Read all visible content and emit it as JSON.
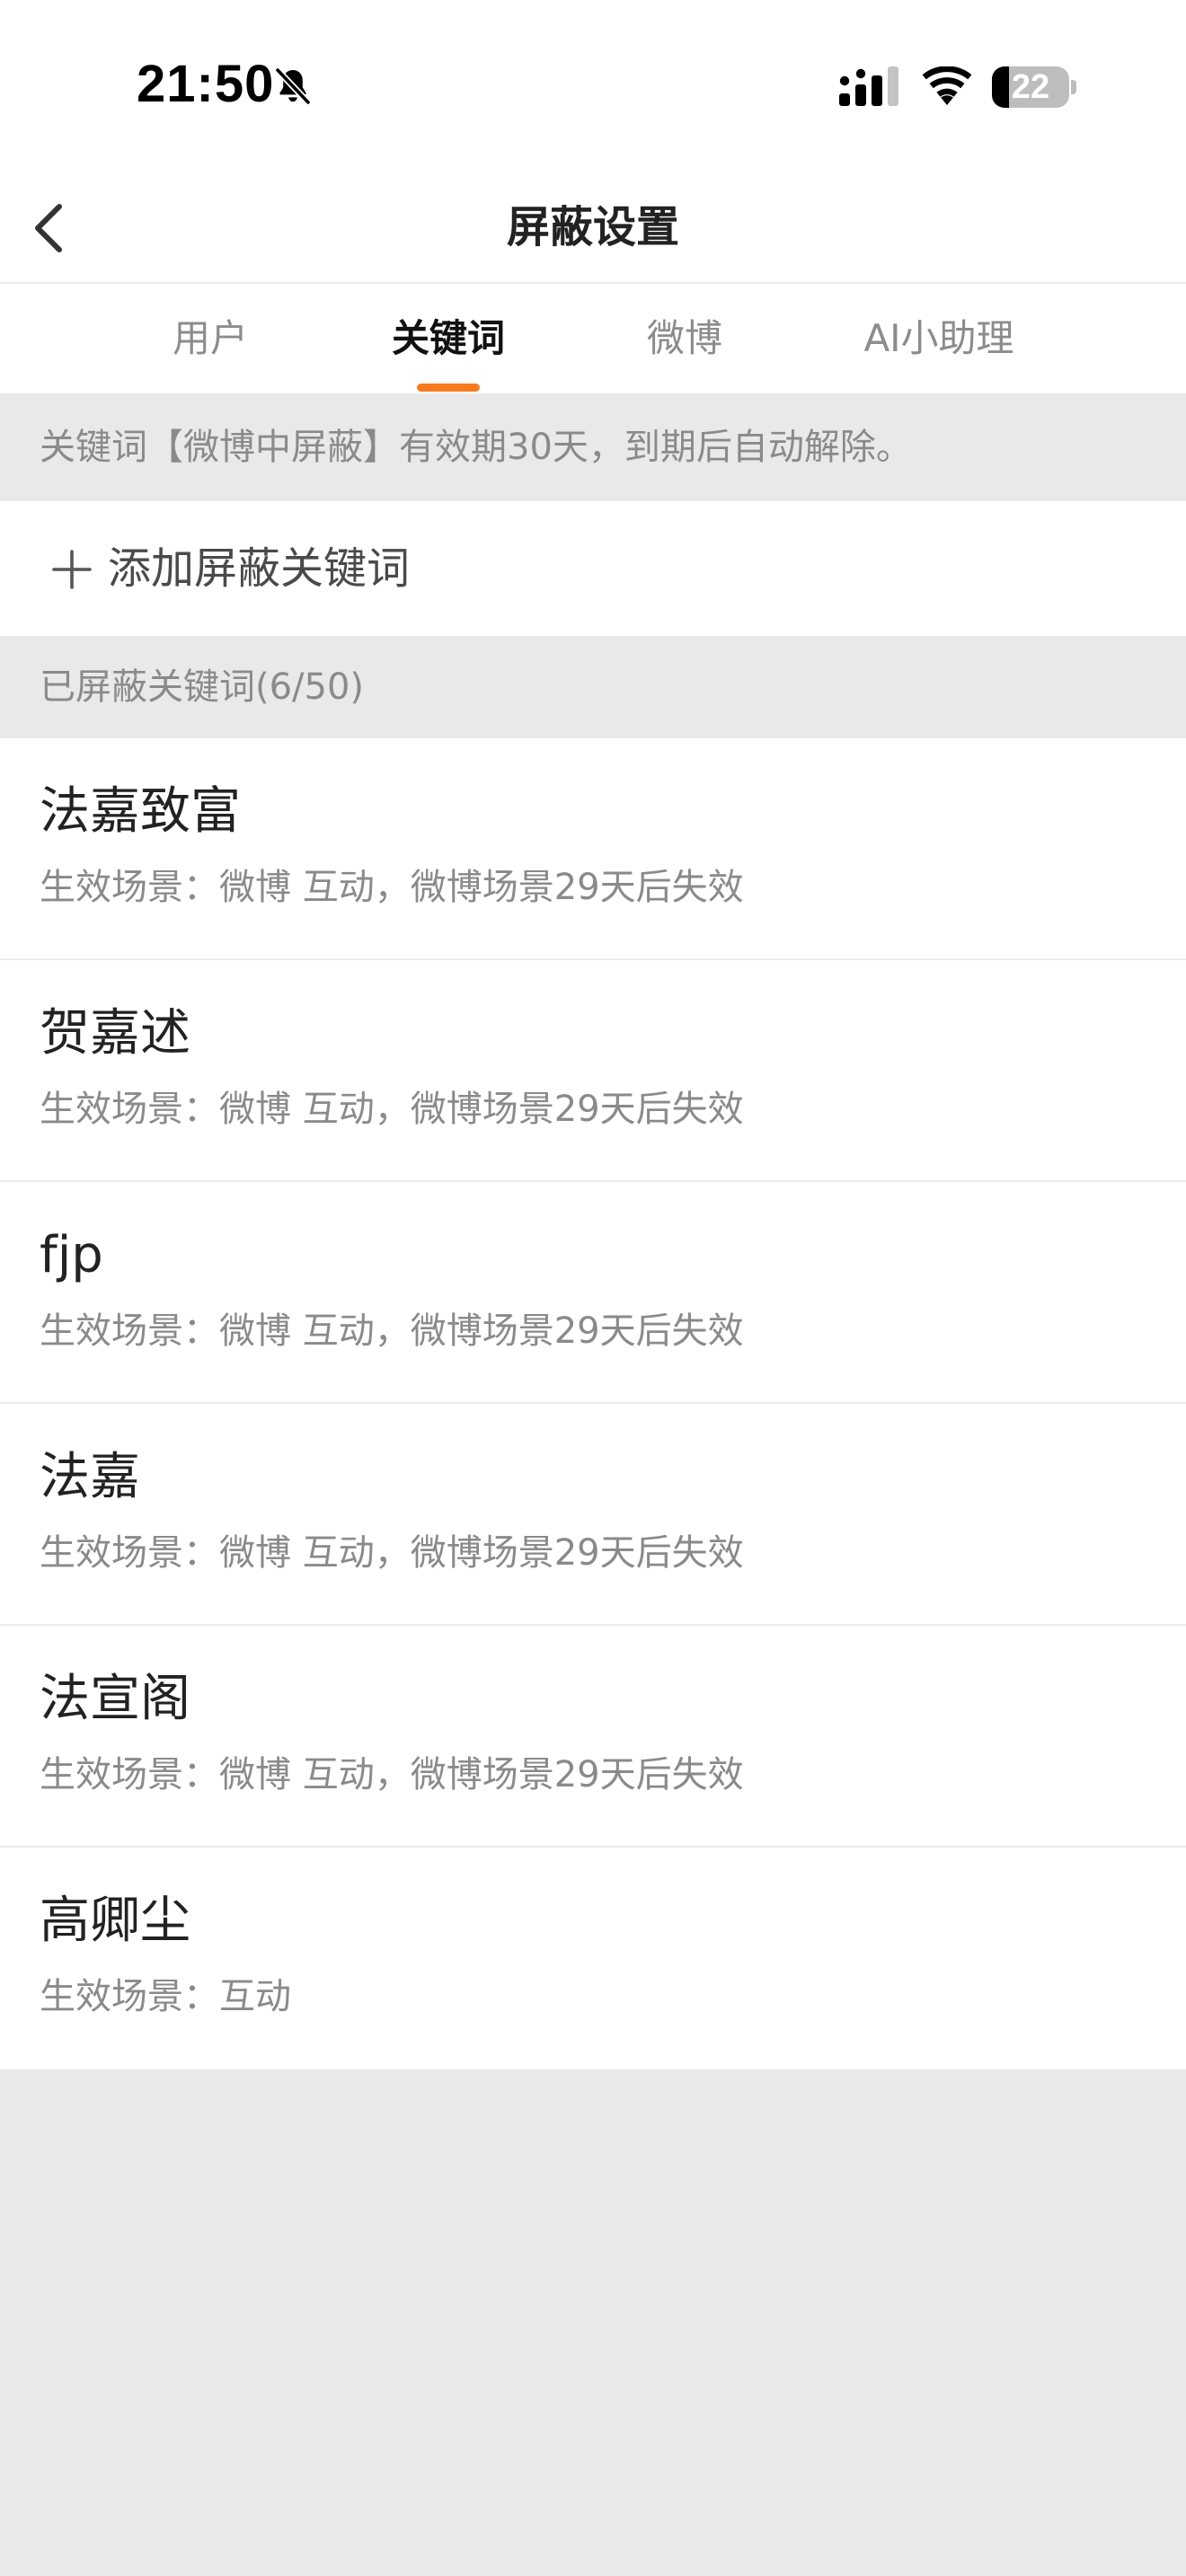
{
  "status_bar": {
    "time": "21:50",
    "silent_icon": "bell-slash-icon",
    "signal_icon": "cellular-signal-icon",
    "wifi_icon": "wifi-icon",
    "battery_level": "22",
    "battery_fraction": 0.22
  },
  "nav": {
    "title": "屏蔽设置",
    "back_icon": "chevron-left-icon"
  },
  "tabs": [
    {
      "label": "用户",
      "active": false
    },
    {
      "label": "关键词",
      "active": true
    },
    {
      "label": "微博",
      "active": false
    },
    {
      "label": "AI小助理",
      "active": false
    }
  ],
  "accent_color": "#f77b1e",
  "notice": "关键词【微博中屏蔽】有效期30天，到期后自动解除。",
  "add_keyword": {
    "icon": "plus-icon",
    "label": "添加屏蔽关键词"
  },
  "section_header": "已屏蔽关键词(6/50)",
  "keywords": [
    {
      "text": "法嘉致富",
      "scene": "生效场景：微博 互动，微博场景29天后失效"
    },
    {
      "text": "贺嘉述",
      "scene": "生效场景：微博 互动，微博场景29天后失效"
    },
    {
      "text": "fjp",
      "scene": "生效场景：微博 互动，微博场景29天后失效"
    },
    {
      "text": "法嘉",
      "scene": "生效场景：微博 互动，微博场景29天后失效"
    },
    {
      "text": "法宣阁",
      "scene": "生效场景：微博 互动，微博场景29天后失效"
    },
    {
      "text": "高卿尘",
      "scene": "生效场景：互动"
    }
  ]
}
